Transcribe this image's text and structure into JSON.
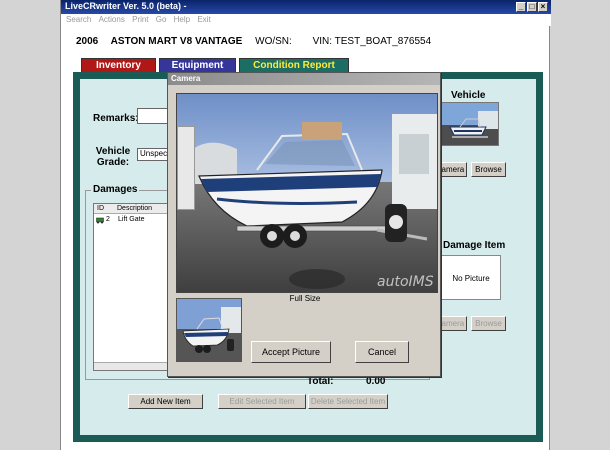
{
  "window": {
    "title": "LiveCRwriter Ver. 5.0 (beta) -",
    "controls": {
      "minimize": "_",
      "maximize": "□",
      "close": "×"
    },
    "menu": [
      "Search",
      "Actions",
      "Print",
      "Go",
      "Help",
      "Exit"
    ]
  },
  "header": {
    "year": "2006",
    "vehicle": "ASTON MART V8 VANTAGE",
    "wo_label": "WO/SN:",
    "vin": "VIN: TEST_BOAT_876554"
  },
  "tabs": [
    {
      "label": "Inventory",
      "color": "#b01818"
    },
    {
      "label": "Equipment",
      "color": "#35359a"
    },
    {
      "label": "Condition Report",
      "color": "#1c6e65",
      "active": true
    }
  ],
  "form": {
    "remarks_label": "Remarks:",
    "remarks_value": "",
    "grade_label": "Vehicle Grade:",
    "grade_value": "Unspecifie",
    "damages_label": "Damages",
    "damages_columns": [
      "ID",
      "Description"
    ],
    "damages_rows": [
      {
        "id": "2",
        "description": "Lift Gate"
      }
    ],
    "total_label": "Total:",
    "total_value": "0.00",
    "add_item": "Add New Item",
    "edit_item": "Edit Selected Item",
    "delete_item": "Delete Selected Item"
  },
  "vehicle_panel": {
    "label": "Vehicle",
    "camera": "Camera",
    "browse": "Browse"
  },
  "damage_panel": {
    "label": "Damage Item",
    "no_picture": "No Picture",
    "camera": "Camera",
    "browse": "Browse"
  },
  "camera_dialog": {
    "title": "Camera",
    "full_size": "Full Size",
    "accept": "Accept Picture",
    "cancel": "Cancel",
    "watermark": "autoIMS"
  },
  "colors": {
    "frame": "#1a5c55",
    "titlebar": "#0a246a"
  },
  "icons": {
    "row_icon": "car-icon"
  }
}
